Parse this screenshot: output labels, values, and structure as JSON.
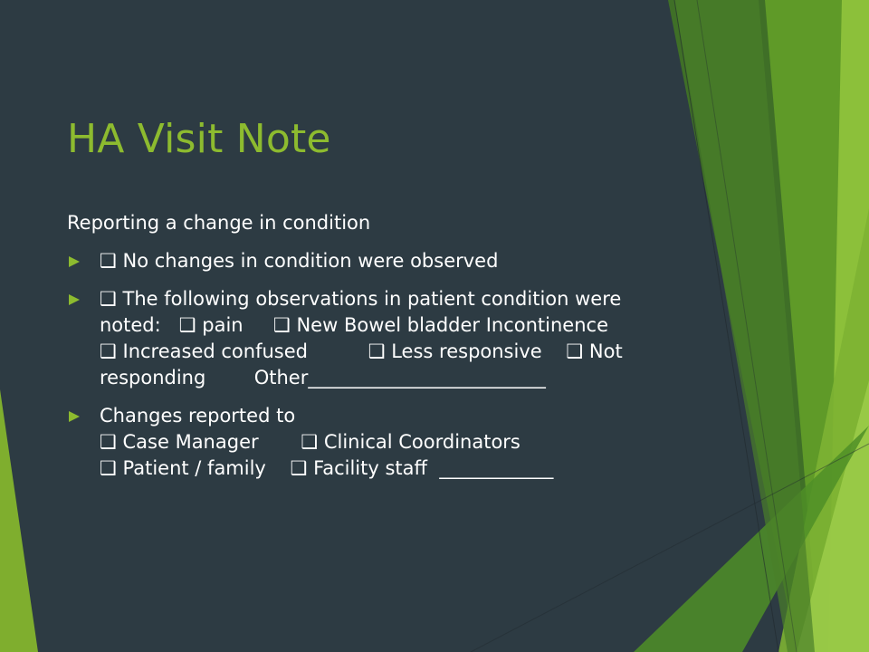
{
  "slide": {
    "title": "HA Visit Note",
    "intro": "Reporting a change in condition",
    "bullets": [
      {
        "lines": [
          "❑ No changes in condition were observed"
        ]
      },
      {
        "lines": [
          "❑ The following observations in patient condition were",
          "noted:   ❑ pain     ❑ New Bowel bladder Incontinence",
          "❑ Increased confused          ❑ Less responsive    ❑ Not",
          "responding        Other_________________________"
        ]
      },
      {
        "lines": [
          "Changes reported to",
          "❑ Case Manager       ❑ Clinical Coordinators",
          "❑ Patient / family    ❑ Facility staff  ____________"
        ]
      }
    ]
  },
  "theme": {
    "background": "#2d3b43",
    "accent": "#8dbb2f",
    "bullet_icon": "triangle-arrow-icon"
  }
}
